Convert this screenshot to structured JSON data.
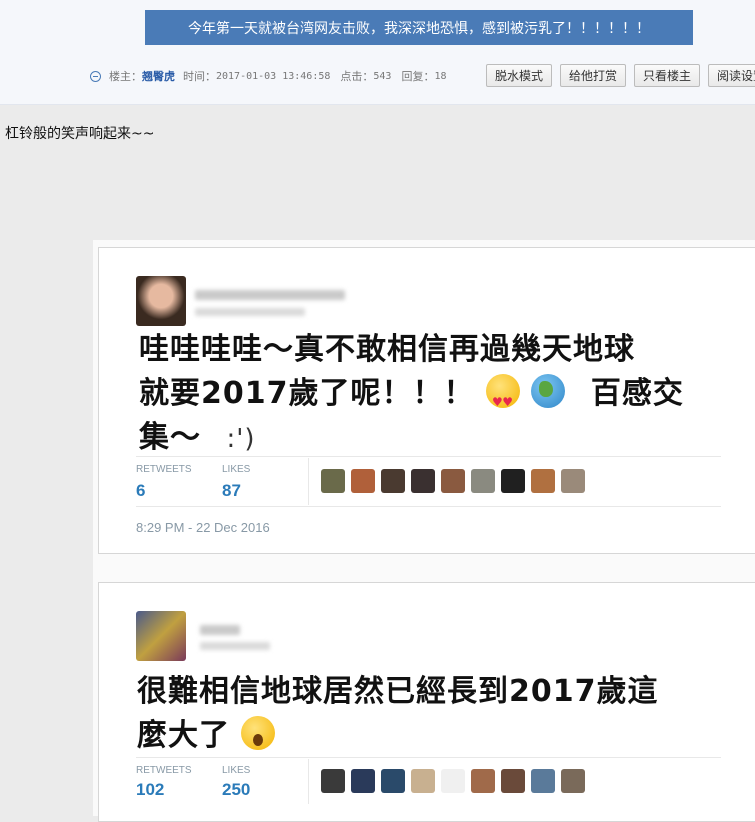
{
  "thread": {
    "title": "今年第一天就被台湾网友击败，我深深地恐惧，感到被污乳了！！！！！！",
    "author_label": "楼主：",
    "author": "翘臀虎",
    "time_label": "时间：",
    "time": "2017-01-03 13:46:58",
    "clicks_label": "点击：",
    "clicks": "543",
    "replies_label": "回复：",
    "replies": "18"
  },
  "toolbar": {
    "dehydrate": "脱水模式",
    "tip": "给他打赏",
    "only_op": "只看楼主",
    "read_settings": "阅读设置"
  },
  "post": {
    "text": "杠铃般的笑声响起来~~"
  },
  "tweets": [
    {
      "line1": "哇哇哇哇～真不敢相信再過幾天地球",
      "line2": "就要2017歲了呢！！！",
      "line2b": "百感交",
      "line3": "集～",
      "smiley": ":')",
      "retweets_label": "RETWEETS",
      "retweets": "6",
      "likes_label": "LIKES",
      "likes": "87",
      "timestamp": "8:29 PM - 22 Dec 2016",
      "liker_colors": [
        "#6a6a4a",
        "#b0603a",
        "#4a3a30",
        "#3a3030",
        "#8a5a40",
        "#8a8a80",
        "#202020",
        "#b07040",
        "#9a8a7a"
      ]
    },
    {
      "line1": "很難相信地球居然已經長到2017歲這",
      "line2": "麼大了",
      "retweets_label": "RETWEETS",
      "retweets": "102",
      "likes_label": "LIKES",
      "likes": "250",
      "liker_colors": [
        "#3a3a3a",
        "#2a3a5a",
        "#2a4a6a",
        "#c8b090",
        "#f0f0f0",
        "#a06a4a",
        "#6a4a3a",
        "#5a7a9a",
        "#7a6a5a"
      ]
    }
  ]
}
